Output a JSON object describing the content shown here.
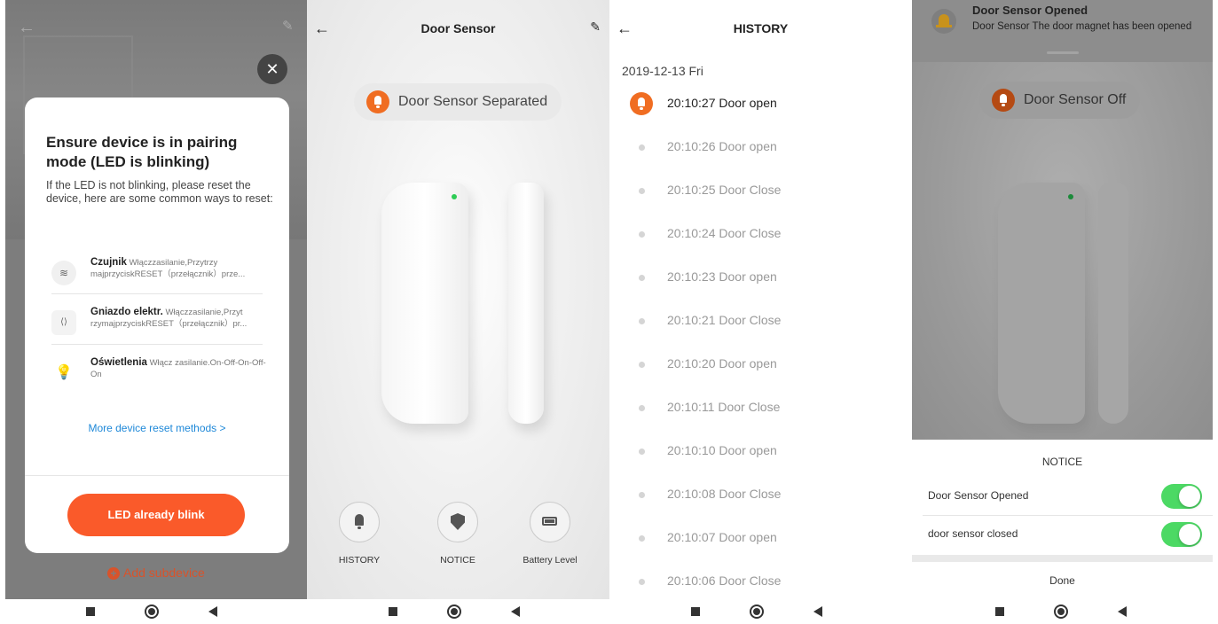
{
  "pairing": {
    "title": "Ensure device is in pairing mode (LED is blinking)",
    "description": "If the LED is not blinking, please reset the device, here are some common ways to reset:",
    "methods": [
      {
        "name": "Czujnik",
        "text": "Włączzasilanie,Przytrzy majprzyciskRESET（przełącznik）prze..."
      },
      {
        "name": "Gniazdo elektr.",
        "text": "Włączzasilanie,Przyt rzymajprzyciskRESET（przełącznik）pr..."
      },
      {
        "name": "Oświetlenia",
        "text": "Włącz zasilanie.On-Off-On-Off-On"
      }
    ],
    "more_link": "More device reset methods >",
    "confirm_button": "LED already blink",
    "add_subdevice": "Add subdevice",
    "close_glyph": "✕"
  },
  "device": {
    "title": "Door Sensor",
    "status": "Door Sensor Separated",
    "tabs": [
      {
        "label": "HISTORY",
        "icon": "bell-icon"
      },
      {
        "label": "NOTICE",
        "icon": "shield-icon"
      },
      {
        "label": "Battery Level",
        "icon": "battery-icon"
      }
    ]
  },
  "history": {
    "title": "HISTORY",
    "date": "2019-12-13 Fri",
    "entries": [
      "20:10:27 Door open",
      "20:10:26 Door open",
      "20:10:25 Door Close",
      "20:10:24 Door Close",
      "20:10:23 Door open",
      "20:10:21 Door Close",
      "20:10:20 Door open",
      "20:10:11 Door Close",
      "20:10:10 Door open",
      "20:10:08 Door Close",
      "20:10:07 Door open",
      "20:10:06 Door Close"
    ]
  },
  "notice": {
    "notification_title": "Door Sensor Opened",
    "notification_body": "Door Sensor The door magnet has been opened",
    "status": "Door Sensor Off",
    "sheet_title": "NOTICE",
    "options": [
      {
        "label": "Door Sensor Opened",
        "enabled": true
      },
      {
        "label": "door sensor closed",
        "enabled": true
      }
    ],
    "done": "Done"
  },
  "colors": {
    "accent_orange": "#fa5a2a",
    "link_blue": "#1e88d8",
    "toggle_green": "#4cd964"
  }
}
